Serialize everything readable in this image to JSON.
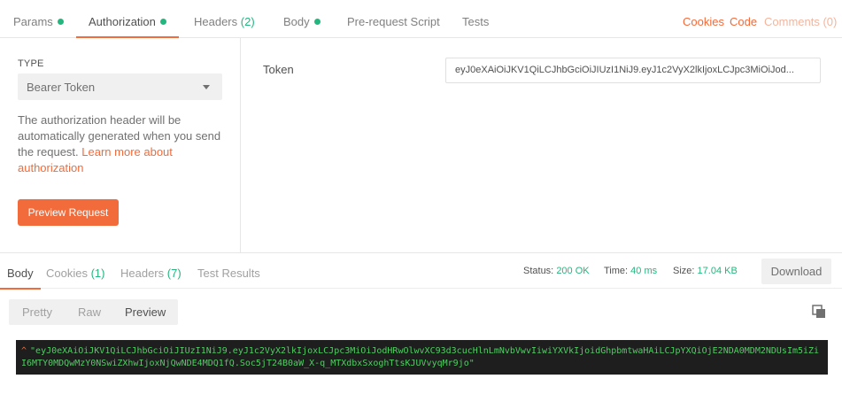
{
  "request_tabs": {
    "params": "Params",
    "authorization": "Authorization",
    "headers": "Headers",
    "headers_count": "(2)",
    "body": "Body",
    "pre_request_script": "Pre-request Script",
    "tests": "Tests"
  },
  "right_links": {
    "cookies": "Cookies",
    "code": "Code",
    "comments": "Comments (0)"
  },
  "auth": {
    "type_label": "TYPE",
    "type_value": "Bearer Token",
    "description_start": "The authorization header will be automatically generated when you send the request. ",
    "learn_more": "Learn more about authorization",
    "preview_button": "Preview Request",
    "token_label": "Token",
    "token_value": "eyJ0eXAiOiJKV1QiLCJhbGciOiJIUzI1NiJ9.eyJ1c2VyX2lkIjoxLCJpc3MiOiJod..."
  },
  "response": {
    "tabs": {
      "body": "Body",
      "cookies": "Cookies",
      "cookies_count": "(1)",
      "headers": "Headers",
      "headers_count": "(7)",
      "test_results": "Test Results"
    },
    "status_label": "Status:",
    "status_value": "200 OK",
    "time_label": "Time:",
    "time_value": "40 ms",
    "size_label": "Size:",
    "size_value": "17.04 KB",
    "download_button": "Download",
    "view_modes": {
      "pretty": "Pretty",
      "raw": "Raw",
      "preview": "Preview"
    },
    "body_caret": "^",
    "body_text": "\"eyJ0eXAiOiJKV1QiLCJhbGciOiJIUzI1NiJ9.eyJ1c2VyX2lkIjoxLCJpc3MiOiJodHRwOlwvXC93d3cucHlnLmNvbVwvIiwiYXVkIjoidGhpbmtwaHAiLCJpYXQiOjE2NDA0MDM2NDUsIm5iZiI6MTY0MDQwMzY0NSwiZXhwIjoxNjQwNDE4MDQ1fQ.Soc5jT24B0aW_X-q_MTXdbxSxoghTtsKJUVvyqMr9jo\""
  },
  "colors": {
    "accent": "#f26b3a",
    "success": "#26b47f",
    "code_background": "#1e1e1e"
  },
  "icons": {
    "copy": "copy-icon",
    "dropdown": "chevron-down-icon"
  }
}
